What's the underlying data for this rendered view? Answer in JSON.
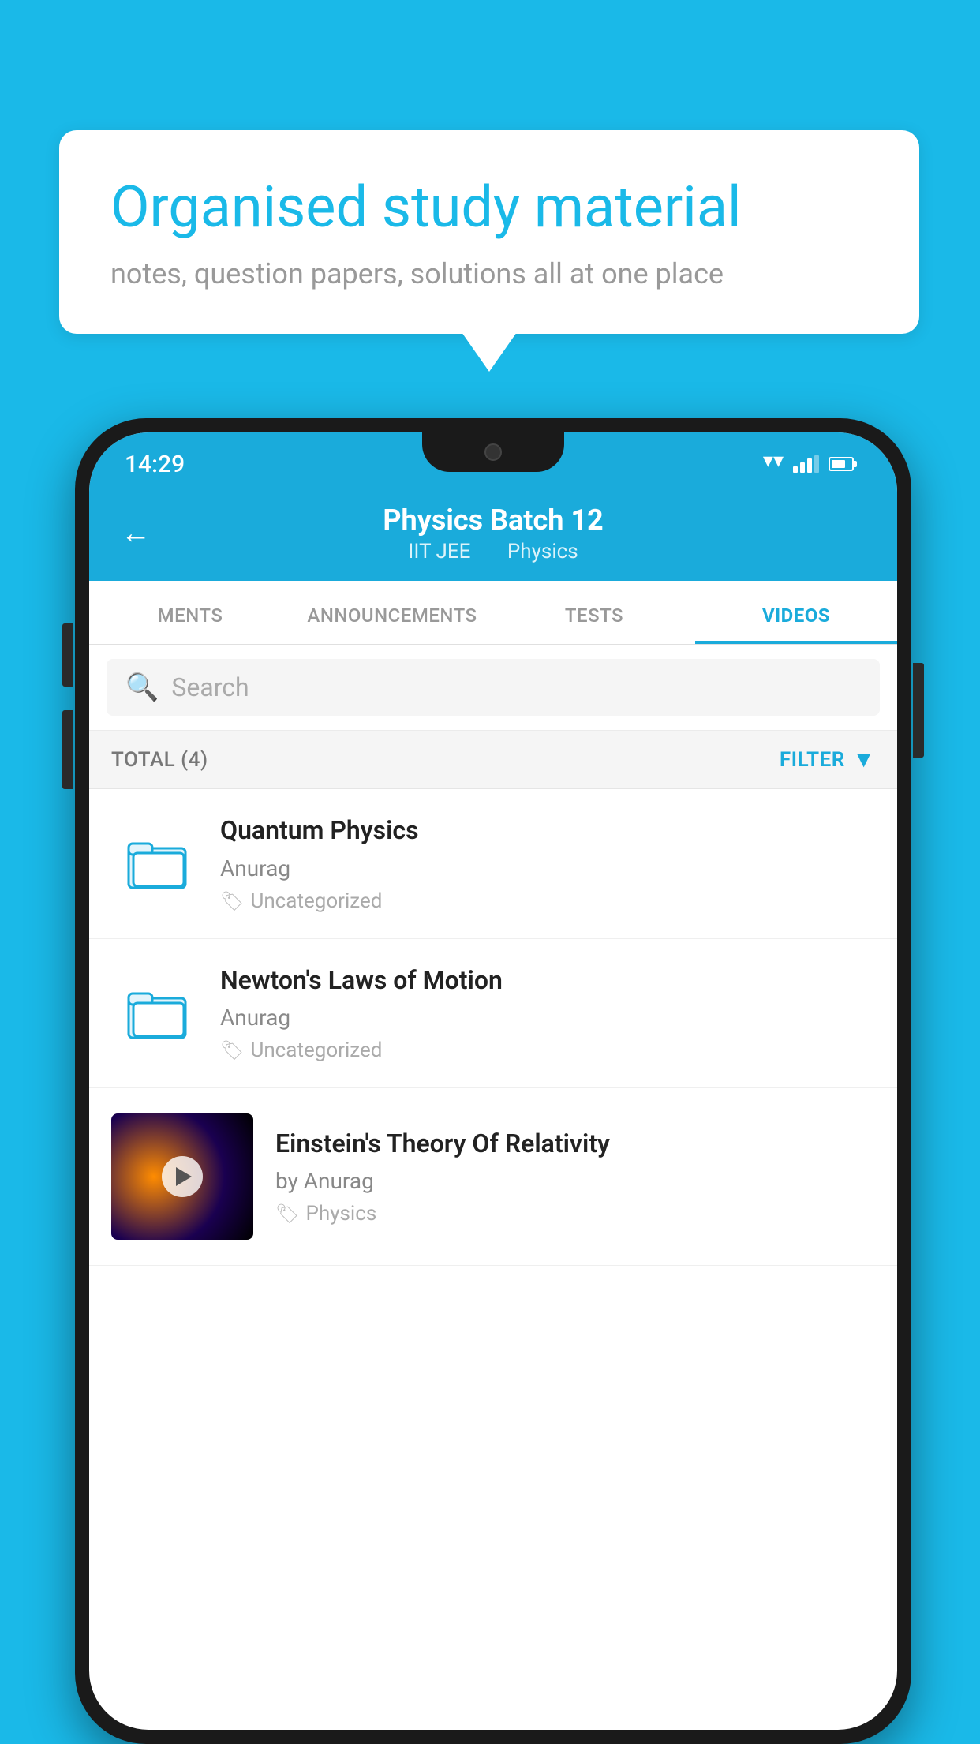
{
  "background_color": "#1ab9e8",
  "bubble": {
    "title": "Organised study material",
    "subtitle": "notes, question papers, solutions all at one place"
  },
  "phone": {
    "status_bar": {
      "time": "14:29"
    },
    "header": {
      "back_label": "←",
      "title": "Physics Batch 12",
      "subtitle_part1": "IIT JEE",
      "subtitle_part2": "Physics"
    },
    "tabs": [
      {
        "label": "MENTS",
        "active": false
      },
      {
        "label": "ANNOUNCEMENTS",
        "active": false
      },
      {
        "label": "TESTS",
        "active": false
      },
      {
        "label": "VIDEOS",
        "active": true
      }
    ],
    "search": {
      "placeholder": "Search"
    },
    "filter_bar": {
      "total_label": "TOTAL (4)",
      "filter_label": "FILTER"
    },
    "video_items": [
      {
        "id": 1,
        "type": "folder",
        "title": "Quantum Physics",
        "author": "Anurag",
        "tag": "Uncategorized"
      },
      {
        "id": 2,
        "type": "folder",
        "title": "Newton's Laws of Motion",
        "author": "Anurag",
        "tag": "Uncategorized"
      },
      {
        "id": 3,
        "type": "video",
        "title": "Einstein's Theory Of Relativity",
        "author": "by Anurag",
        "tag": "Physics"
      }
    ]
  }
}
